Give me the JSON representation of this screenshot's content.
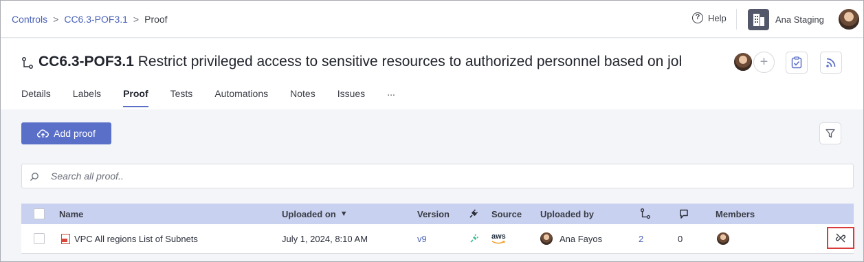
{
  "breadcrumb": {
    "items": [
      "Controls",
      "CC6.3-POF3.1"
    ],
    "separator": ">",
    "current": "Proof"
  },
  "topbar": {
    "help_label": "Help",
    "org_name": "Ana Staging"
  },
  "control": {
    "id": "CC6.3-POF3.1",
    "title": "Restrict privileged access to sensitive resources to authorized personnel based on job f"
  },
  "tabs": [
    "Details",
    "Labels",
    "Proof",
    "Tests",
    "Automations",
    "Notes",
    "Issues"
  ],
  "tabs_more": "...",
  "toolbar": {
    "add_proof_label": "Add proof"
  },
  "search": {
    "placeholder": "Search all proof.."
  },
  "table": {
    "headers": {
      "name": "Name",
      "uploaded_on": "Uploaded on",
      "version": "Version",
      "source": "Source",
      "uploaded_by": "Uploaded by",
      "members": "Members"
    },
    "sort_indicator": "▼",
    "rows": [
      {
        "name": "VPC All regions List of Subnets",
        "uploaded_on": "July 1, 2024, 8:10 AM",
        "version": "v9",
        "source": "aws",
        "uploaded_by": "Ana Fayos",
        "controls_count": "2",
        "comments_count": "0"
      }
    ]
  },
  "colors": {
    "accent": "#5a6fc7",
    "header_row": "#c9d1f0",
    "link": "#4a62b8",
    "highlight": "#d93a3a",
    "plugin": "#3fbf8f",
    "aws": "#f29a1d"
  }
}
